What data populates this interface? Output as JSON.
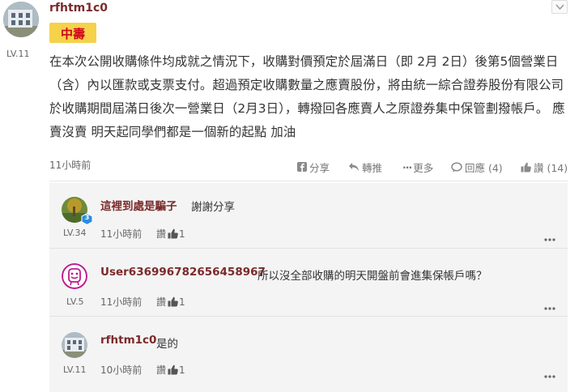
{
  "post": {
    "username": "rfhtm1c0",
    "level": "LV.11",
    "badge": "中壽",
    "body": "在本次公開收購條件均成就之情況下，收購對價預定於屆滿日（即 2月 2日）後第5個營業日（含）內以匯款或支票支付。超過預定收購數量之應賣股份，將由統一綜合證券股份有限公司於收購期間屆滿日後次一營業日（2月3日），轉撥回各應賣人之原證券集中保管劃撥帳戶。 應賣沒賣 明天起同學們都是一個新的起點 加油",
    "time": "11小時前",
    "actions": {
      "share": "分享",
      "push": "轉推",
      "more": "更多",
      "reply": "回應 (4)",
      "like": "讚 (14)"
    }
  },
  "comments": [
    {
      "username": "這裡到處是騙子",
      "text": "謝謝分享",
      "level": "LV.34",
      "time": "11小時前",
      "like_label": "讚",
      "like_count": "1",
      "vip_badge": "3"
    },
    {
      "username": "User636996782656458967",
      "text": "所以沒全部收購的明天開盤前會進集保帳戶嗎？",
      "level": "LV.5",
      "time": "11小時前",
      "like_label": "讚",
      "like_count": "1"
    },
    {
      "username": "rfhtm1c0",
      "text": "是的",
      "level": "LV.11",
      "time": "10小時前",
      "like_label": "讚",
      "like_count": "1"
    }
  ],
  "colors": {
    "username": "#7a2a2a",
    "badge_bg": "#f5d24a",
    "badge_text": "#d0021b",
    "comment_bg": "#f4f4f4"
  }
}
